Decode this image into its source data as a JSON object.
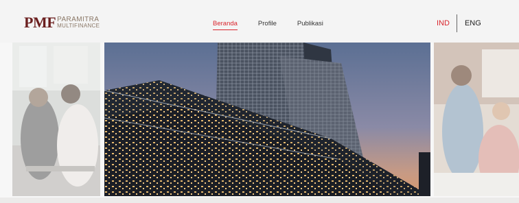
{
  "brand": {
    "mark": "PMF",
    "line1": "PARAMITRA",
    "line2": "MULTIFINANCE"
  },
  "nav": {
    "items": [
      {
        "label": "Beranda",
        "active": true
      },
      {
        "label": "Profile",
        "active": false
      },
      {
        "label": "Publikasi",
        "active": false
      }
    ]
  },
  "language": {
    "options": [
      "IND",
      "ENG"
    ],
    "selected": "IND"
  },
  "carousel": {
    "slides": [
      {
        "subject": "office-meeting-photo"
      },
      {
        "subject": "glass-skyscraper-photo"
      },
      {
        "subject": "office-team-photo"
      }
    ]
  },
  "colors": {
    "accent": "#d9242c",
    "brand": "#6b1f1f",
    "navbar_bg": "#f4f4f4"
  }
}
